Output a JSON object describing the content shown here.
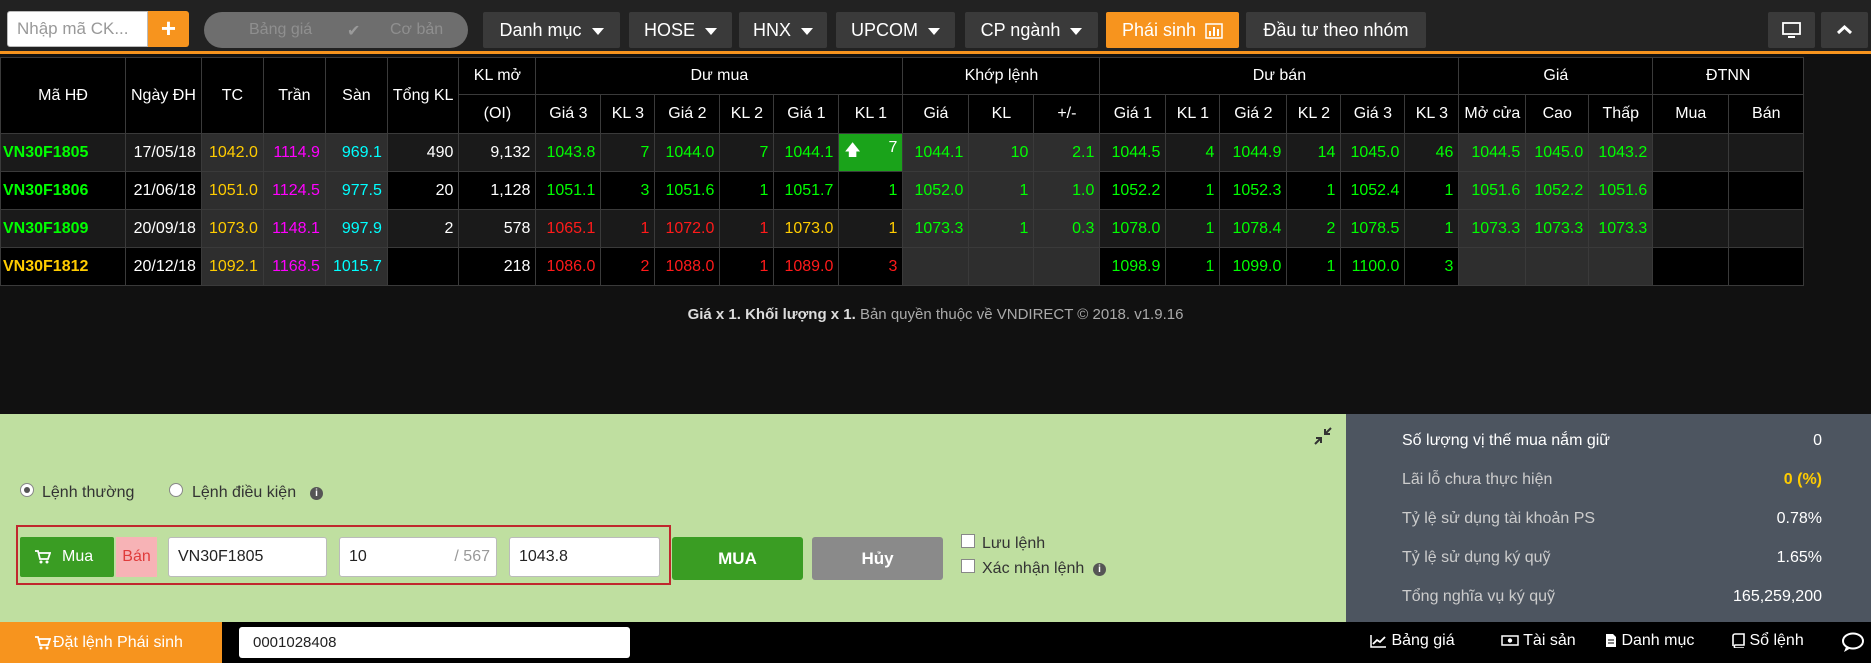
{
  "topbar": {
    "search_placeholder": "Nhập mã CK...",
    "plus": "+",
    "toggle_left": "Bảng giá",
    "toggle_right": "Cơ bản",
    "menus": [
      "Danh mục",
      "HOSE",
      "HNX",
      "UPCOM",
      "CP ngành",
      "Phái sinh",
      "Đầu tư theo nhóm"
    ]
  },
  "table": {
    "h": {
      "ma_hd": "Mã HĐ",
      "ngay": "Ngày ĐH",
      "tc": "TC",
      "tran": "Trần",
      "san": "Sàn",
      "tong_kl": "Tổng KL",
      "kl_mo": "KL mở",
      "oi": "(OI)",
      "du_mua": "Dư mua",
      "khop": "Khớp lệnh",
      "du_ban": "Dư bán",
      "gia": "Giá",
      "dtnn": "ĐTNN",
      "gia3": "Giá 3",
      "kl3": "KL 3",
      "gia2": "Giá 2",
      "kl2": "KL 2",
      "gia1": "Giá 1",
      "kl1": "KL 1",
      "kgia": "Giá",
      "kkl": "KL",
      "pm": "+/-",
      "mo": "Mở cửa",
      "cao": "Cao",
      "thap": "Thấp",
      "mua": "Mua",
      "ban": "Bán"
    },
    "rows": [
      [
        "VN30F1805",
        "17/05/18",
        "1042.0",
        "1114.9",
        "969.1",
        "490",
        "9,132",
        "1043.8",
        "7",
        "1044.0",
        "7",
        "1044.1",
        "7",
        "1044.1",
        "10",
        "2.1",
        "1044.5",
        "4",
        "1044.9",
        "14",
        "1045.0",
        "46",
        "1044.5",
        "1045.0",
        "1043.2",
        "",
        ""
      ],
      [
        "VN30F1806",
        "21/06/18",
        "1051.0",
        "1124.5",
        "977.5",
        "20",
        "1,128",
        "1051.1",
        "3",
        "1051.6",
        "1",
        "1051.7",
        "1",
        "1052.0",
        "1",
        "1.0",
        "1052.2",
        "1",
        "1052.3",
        "1",
        "1052.4",
        "1",
        "1051.6",
        "1052.2",
        "1051.6",
        "",
        ""
      ],
      [
        "VN30F1809",
        "20/09/18",
        "1073.0",
        "1148.1",
        "997.9",
        "2",
        "578",
        "1065.1",
        "1",
        "1072.0",
        "1",
        "1073.0",
        "1",
        "1073.3",
        "1",
        "0.3",
        "1078.0",
        "1",
        "1078.4",
        "2",
        "1078.5",
        "1",
        "1073.3",
        "1073.3",
        "1073.3",
        "",
        ""
      ],
      [
        "VN30F1812",
        "20/12/18",
        "1092.1",
        "1168.5",
        "1015.7",
        "",
        "218",
        "1086.0",
        "2",
        "1088.0",
        "1",
        "1089.0",
        "3",
        "",
        "",
        "",
        "1098.9",
        "1",
        "1099.0",
        "1",
        "1100.0",
        "3",
        "",
        "",
        "",
        "",
        ""
      ]
    ]
  },
  "copyright": {
    "bold": "Giá x 1. Khối lượng x 1.",
    "rest": " Bản quyền thuộc về VNDIRECT © 2018. v1.9.16"
  },
  "order": {
    "radio1": "Lệnh thường",
    "radio2": "Lệnh điều kiện",
    "buy_tab": "Mua",
    "sell_tab": "Bán",
    "symbol": "VN30F1805",
    "qty": "10",
    "max": "/ 567",
    "price": "1043.8",
    "submit": "MUA",
    "cancel": "Hủy",
    "chk1": "Lưu lệnh",
    "chk2": "Xác nhận lệnh"
  },
  "info": [
    {
      "label": "Số lượng vị thế mua nắm giữ",
      "value": "0"
    },
    {
      "label": "Lãi lỗ chưa thực hiện",
      "value": "0 (%)"
    },
    {
      "label": "Tỷ lệ sử dụng tài khoản PS",
      "value": "0.78%"
    },
    {
      "label": "Tỷ lệ sử dụng ký quỹ",
      "value": "1.65%"
    },
    {
      "label": "Tổng nghĩa vụ ký quỹ",
      "value": "165,259,200"
    }
  ],
  "bottom": {
    "order_btn": "Đặt lệnh Phái sinh",
    "account": "0001028408",
    "links": [
      "Bảng giá",
      "Tài sản",
      "Danh mục",
      "Sổ lệnh"
    ]
  }
}
